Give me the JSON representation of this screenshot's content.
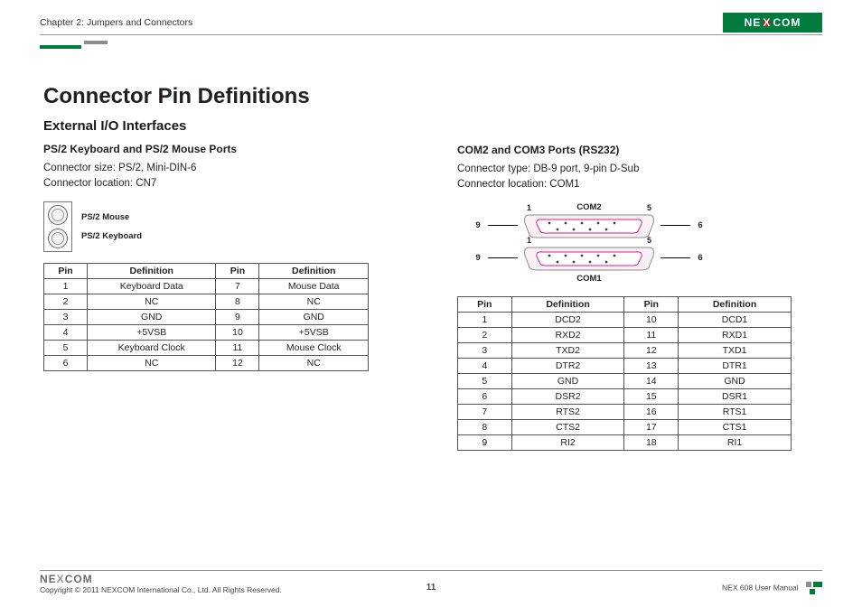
{
  "header": {
    "chapter": "Chapter 2: Jumpers and Connectors",
    "logo_text": "NE COM",
    "logo_x": "X"
  },
  "title": "Connector Pin Definitions",
  "subtitle": "External I/O Interfaces",
  "left": {
    "heading": "PS/2 Keyboard and PS/2 Mouse Ports",
    "spec1": "Connector size: PS/2, Mini-DIN-6",
    "spec2": "Connector location: CN7",
    "port_label_top": "PS/2 Mouse",
    "port_label_bottom": "PS/2 Keyboard",
    "table": {
      "h1": "Pin",
      "h2": "Definition",
      "h3": "Pin",
      "h4": "Definition",
      "rows": [
        {
          "p1": "1",
          "d1": "Keyboard Data",
          "p2": "7",
          "d2": "Mouse Data"
        },
        {
          "p1": "2",
          "d1": "NC",
          "p2": "8",
          "d2": "NC"
        },
        {
          "p1": "3",
          "d1": "GND",
          "p2": "9",
          "d2": "GND"
        },
        {
          "p1": "4",
          "d1": "+5VSB",
          "p2": "10",
          "d2": "+5VSB"
        },
        {
          "p1": "5",
          "d1": "Keyboard Clock",
          "p2": "11",
          "d2": "Mouse Clock"
        },
        {
          "p1": "6",
          "d1": "NC",
          "p2": "12",
          "d2": "NC"
        }
      ]
    }
  },
  "right": {
    "heading": "COM2 and COM3 Ports (RS232)",
    "spec1": "Connector type: DB-9 port, 9-pin D-Sub",
    "spec2": "Connector location: COM1",
    "diagram": {
      "top_label": "COM2",
      "bottom_label": "COM1",
      "left_top": "9",
      "mid_tl": "1",
      "mid_tr": "5",
      "right_top": "6",
      "left_bot": "9",
      "mid_bl": "1",
      "mid_br": "5",
      "right_bot": "6"
    },
    "table": {
      "h1": "Pin",
      "h2": "Definition",
      "h3": "Pin",
      "h4": "Definition",
      "rows": [
        {
          "p1": "1",
          "d1": "DCD2",
          "p2": "10",
          "d2": "DCD1"
        },
        {
          "p1": "2",
          "d1": "RXD2",
          "p2": "11",
          "d2": "RXD1"
        },
        {
          "p1": "3",
          "d1": "TXD2",
          "p2": "12",
          "d2": "TXD1"
        },
        {
          "p1": "4",
          "d1": "DTR2",
          "p2": "13",
          "d2": "DTR1"
        },
        {
          "p1": "5",
          "d1": "GND",
          "p2": "14",
          "d2": "GND"
        },
        {
          "p1": "6",
          "d1": "DSR2",
          "p2": "15",
          "d2": "DSR1"
        },
        {
          "p1": "7",
          "d1": "RTS2",
          "p2": "16",
          "d2": "RTS1"
        },
        {
          "p1": "8",
          "d1": "CTS2",
          "p2": "17",
          "d2": "CTS1"
        },
        {
          "p1": "9",
          "d1": "RI2",
          "p2": "18",
          "d2": "RI1"
        }
      ]
    }
  },
  "footer": {
    "logo": "NEXCOM",
    "copyright": "Copyright © 2011 NEXCOM International Co., Ltd. All Rights Reserved.",
    "page": "11",
    "manual": "NEX 608 User Manual"
  }
}
